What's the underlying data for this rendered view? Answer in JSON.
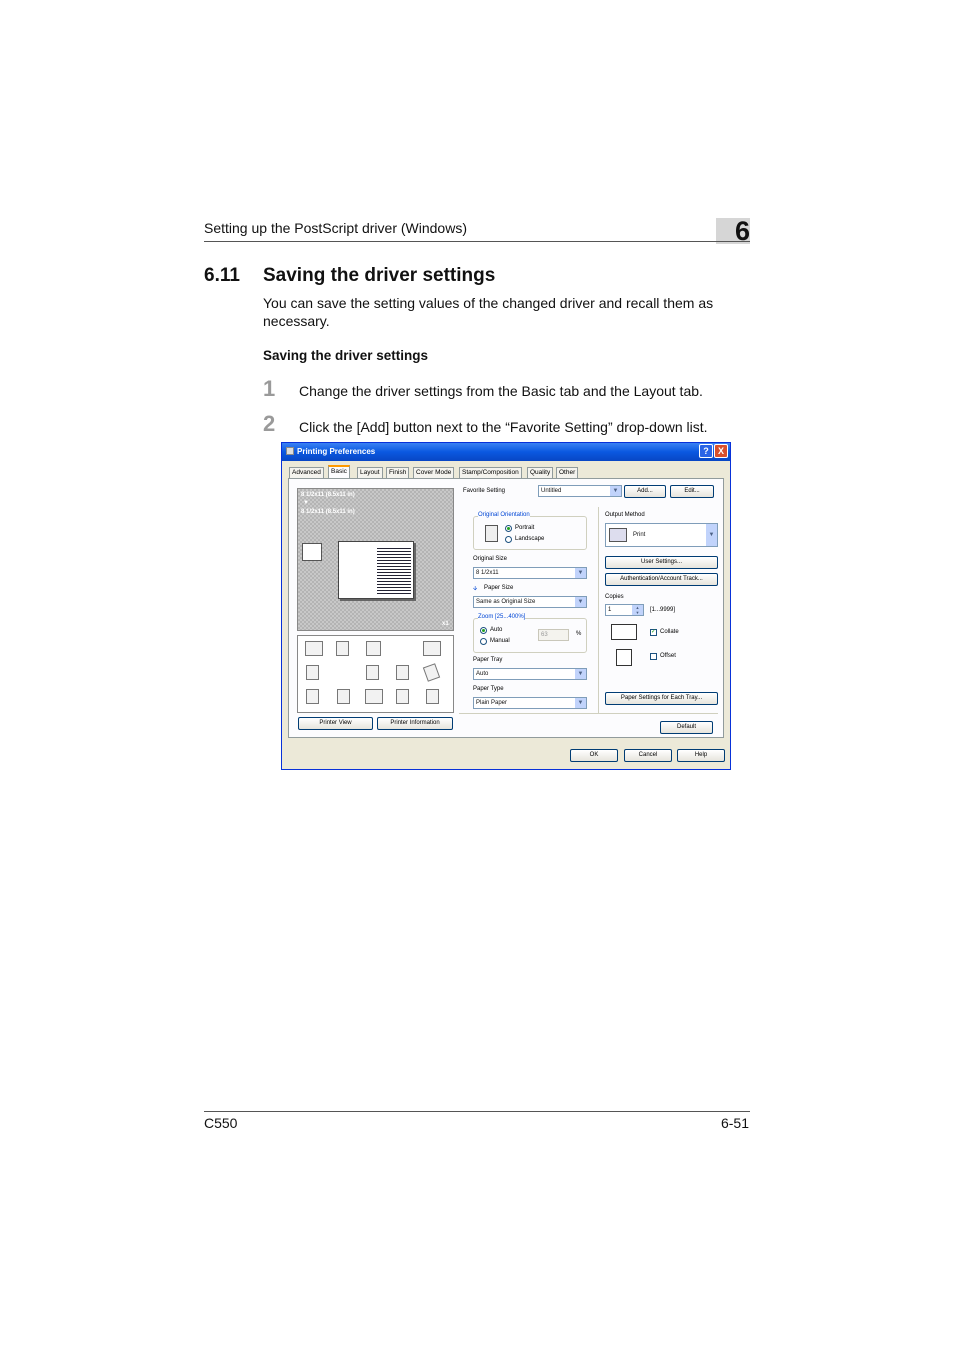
{
  "header": {
    "running_title": "Setting up the PostScript driver (Windows)",
    "chapter_number": "6"
  },
  "section": {
    "number": "6.11",
    "title": "Saving the driver settings",
    "intro": "You can save the setting values of the changed driver and recall them as necessary.",
    "subheading": "Saving the driver settings"
  },
  "steps": [
    {
      "number": "1",
      "text": "Change the driver settings from the Basic tab and the Layout tab."
    },
    {
      "number": "2",
      "text": "Click the [Add] button next to the “Favorite Setting” drop-down list."
    }
  ],
  "dialog": {
    "title": "Printing Preferences",
    "help_glyph": "?",
    "close_glyph": "X",
    "tabs": [
      "Advanced",
      "Basic",
      "Layout",
      "Finish",
      "Cover Mode",
      "Stamp/Composition",
      "Quality",
      "Other"
    ],
    "active_tab": "Basic",
    "preview": {
      "size_line1": "8 1/2x11 (8.5x11 in)",
      "arrow": "▼",
      "size_line2": "8 1/2x11 (8.5x11 in)",
      "scale": "x1"
    },
    "favorite": {
      "label": "Favorite Setting",
      "value": "Untitled",
      "add_label": "Add...",
      "edit_label": "Edit..."
    },
    "orientation": {
      "label": "Original Orientation",
      "portrait": "Portrait",
      "landscape": "Landscape"
    },
    "original_size": {
      "label": "Original Size",
      "value": "8 1/2x11"
    },
    "paper_size": {
      "label": "Paper Size",
      "value": "Same as Original Size"
    },
    "zoom": {
      "label": "Zoom [25...400%]",
      "auto": "Auto",
      "manual": "Manual",
      "value": "63",
      "unit": "%"
    },
    "paper_tray": {
      "label": "Paper Tray",
      "value": "Auto"
    },
    "paper_type": {
      "label": "Paper Type",
      "value": "Plain Paper"
    },
    "output_method": {
      "label": "Output Method",
      "value": "Print"
    },
    "user_settings_label": "User Settings...",
    "auth_label": "Authentication/Account Track...",
    "copies": {
      "label": "Copies",
      "value": "1",
      "range": "[1...9999]"
    },
    "collate_label": "Collate",
    "offset_label": "Offset",
    "paper_each_tray_label": "Paper Settings for Each Tray...",
    "printer_view_label": "Printer View",
    "printer_info_label": "Printer Information",
    "default_label": "Default",
    "ok_label": "OK",
    "cancel_label": "Cancel",
    "help_label": "Help"
  },
  "footer": {
    "model": "C550",
    "page": "6-51"
  }
}
